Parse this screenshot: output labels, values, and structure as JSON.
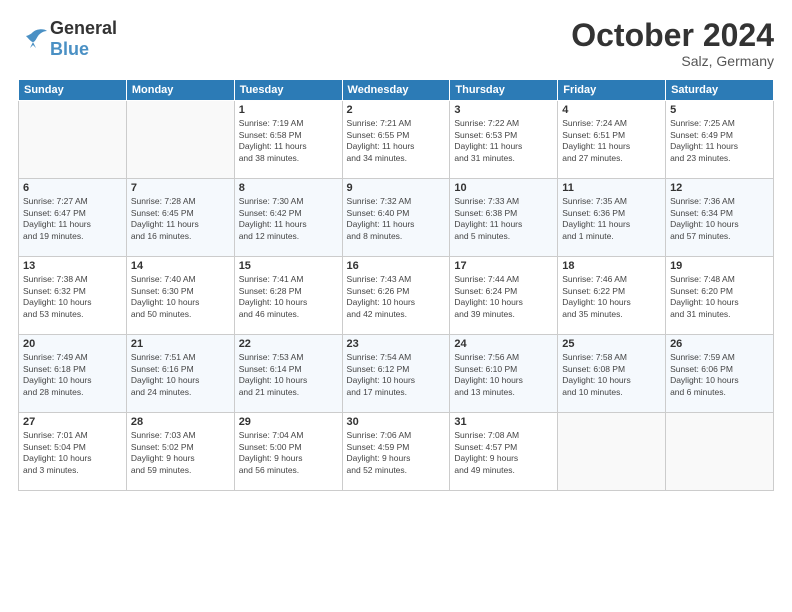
{
  "header": {
    "logo_line1": "General",
    "logo_line2": "Blue",
    "month": "October 2024",
    "location": "Salz, Germany"
  },
  "weekdays": [
    "Sunday",
    "Monday",
    "Tuesday",
    "Wednesday",
    "Thursday",
    "Friday",
    "Saturday"
  ],
  "weeks": [
    [
      {
        "num": "",
        "info": ""
      },
      {
        "num": "",
        "info": ""
      },
      {
        "num": "1",
        "info": "Sunrise: 7:19 AM\nSunset: 6:58 PM\nDaylight: 11 hours\nand 38 minutes."
      },
      {
        "num": "2",
        "info": "Sunrise: 7:21 AM\nSunset: 6:55 PM\nDaylight: 11 hours\nand 34 minutes."
      },
      {
        "num": "3",
        "info": "Sunrise: 7:22 AM\nSunset: 6:53 PM\nDaylight: 11 hours\nand 31 minutes."
      },
      {
        "num": "4",
        "info": "Sunrise: 7:24 AM\nSunset: 6:51 PM\nDaylight: 11 hours\nand 27 minutes."
      },
      {
        "num": "5",
        "info": "Sunrise: 7:25 AM\nSunset: 6:49 PM\nDaylight: 11 hours\nand 23 minutes."
      }
    ],
    [
      {
        "num": "6",
        "info": "Sunrise: 7:27 AM\nSunset: 6:47 PM\nDaylight: 11 hours\nand 19 minutes."
      },
      {
        "num": "7",
        "info": "Sunrise: 7:28 AM\nSunset: 6:45 PM\nDaylight: 11 hours\nand 16 minutes."
      },
      {
        "num": "8",
        "info": "Sunrise: 7:30 AM\nSunset: 6:42 PM\nDaylight: 11 hours\nand 12 minutes."
      },
      {
        "num": "9",
        "info": "Sunrise: 7:32 AM\nSunset: 6:40 PM\nDaylight: 11 hours\nand 8 minutes."
      },
      {
        "num": "10",
        "info": "Sunrise: 7:33 AM\nSunset: 6:38 PM\nDaylight: 11 hours\nand 5 minutes."
      },
      {
        "num": "11",
        "info": "Sunrise: 7:35 AM\nSunset: 6:36 PM\nDaylight: 11 hours\nand 1 minute."
      },
      {
        "num": "12",
        "info": "Sunrise: 7:36 AM\nSunset: 6:34 PM\nDaylight: 10 hours\nand 57 minutes."
      }
    ],
    [
      {
        "num": "13",
        "info": "Sunrise: 7:38 AM\nSunset: 6:32 PM\nDaylight: 10 hours\nand 53 minutes."
      },
      {
        "num": "14",
        "info": "Sunrise: 7:40 AM\nSunset: 6:30 PM\nDaylight: 10 hours\nand 50 minutes."
      },
      {
        "num": "15",
        "info": "Sunrise: 7:41 AM\nSunset: 6:28 PM\nDaylight: 10 hours\nand 46 minutes."
      },
      {
        "num": "16",
        "info": "Sunrise: 7:43 AM\nSunset: 6:26 PM\nDaylight: 10 hours\nand 42 minutes."
      },
      {
        "num": "17",
        "info": "Sunrise: 7:44 AM\nSunset: 6:24 PM\nDaylight: 10 hours\nand 39 minutes."
      },
      {
        "num": "18",
        "info": "Sunrise: 7:46 AM\nSunset: 6:22 PM\nDaylight: 10 hours\nand 35 minutes."
      },
      {
        "num": "19",
        "info": "Sunrise: 7:48 AM\nSunset: 6:20 PM\nDaylight: 10 hours\nand 31 minutes."
      }
    ],
    [
      {
        "num": "20",
        "info": "Sunrise: 7:49 AM\nSunset: 6:18 PM\nDaylight: 10 hours\nand 28 minutes."
      },
      {
        "num": "21",
        "info": "Sunrise: 7:51 AM\nSunset: 6:16 PM\nDaylight: 10 hours\nand 24 minutes."
      },
      {
        "num": "22",
        "info": "Sunrise: 7:53 AM\nSunset: 6:14 PM\nDaylight: 10 hours\nand 21 minutes."
      },
      {
        "num": "23",
        "info": "Sunrise: 7:54 AM\nSunset: 6:12 PM\nDaylight: 10 hours\nand 17 minutes."
      },
      {
        "num": "24",
        "info": "Sunrise: 7:56 AM\nSunset: 6:10 PM\nDaylight: 10 hours\nand 13 minutes."
      },
      {
        "num": "25",
        "info": "Sunrise: 7:58 AM\nSunset: 6:08 PM\nDaylight: 10 hours\nand 10 minutes."
      },
      {
        "num": "26",
        "info": "Sunrise: 7:59 AM\nSunset: 6:06 PM\nDaylight: 10 hours\nand 6 minutes."
      }
    ],
    [
      {
        "num": "27",
        "info": "Sunrise: 7:01 AM\nSunset: 5:04 PM\nDaylight: 10 hours\nand 3 minutes."
      },
      {
        "num": "28",
        "info": "Sunrise: 7:03 AM\nSunset: 5:02 PM\nDaylight: 9 hours\nand 59 minutes."
      },
      {
        "num": "29",
        "info": "Sunrise: 7:04 AM\nSunset: 5:00 PM\nDaylight: 9 hours\nand 56 minutes."
      },
      {
        "num": "30",
        "info": "Sunrise: 7:06 AM\nSunset: 4:59 PM\nDaylight: 9 hours\nand 52 minutes."
      },
      {
        "num": "31",
        "info": "Sunrise: 7:08 AM\nSunset: 4:57 PM\nDaylight: 9 hours\nand 49 minutes."
      },
      {
        "num": "",
        "info": ""
      },
      {
        "num": "",
        "info": ""
      }
    ]
  ]
}
